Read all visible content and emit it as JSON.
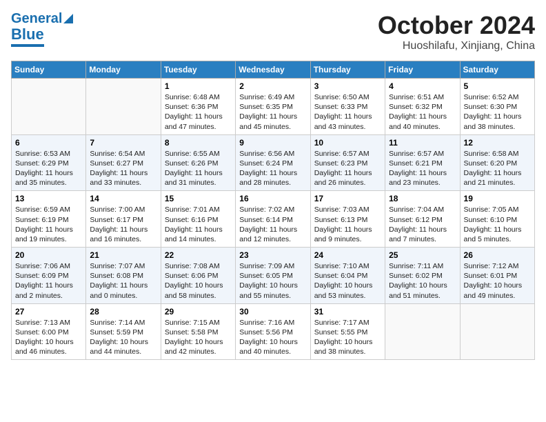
{
  "header": {
    "logo_line1": "General",
    "logo_line2": "Blue",
    "month": "October 2024",
    "location": "Huoshilafu, Xinjiang, China"
  },
  "days_of_week": [
    "Sunday",
    "Monday",
    "Tuesday",
    "Wednesday",
    "Thursday",
    "Friday",
    "Saturday"
  ],
  "weeks": [
    [
      {
        "day": "",
        "info": ""
      },
      {
        "day": "",
        "info": ""
      },
      {
        "day": "1",
        "info": "Sunrise: 6:48 AM\nSunset: 6:36 PM\nDaylight: 11 hours and 47 minutes."
      },
      {
        "day": "2",
        "info": "Sunrise: 6:49 AM\nSunset: 6:35 PM\nDaylight: 11 hours and 45 minutes."
      },
      {
        "day": "3",
        "info": "Sunrise: 6:50 AM\nSunset: 6:33 PM\nDaylight: 11 hours and 43 minutes."
      },
      {
        "day": "4",
        "info": "Sunrise: 6:51 AM\nSunset: 6:32 PM\nDaylight: 11 hours and 40 minutes."
      },
      {
        "day": "5",
        "info": "Sunrise: 6:52 AM\nSunset: 6:30 PM\nDaylight: 11 hours and 38 minutes."
      }
    ],
    [
      {
        "day": "6",
        "info": "Sunrise: 6:53 AM\nSunset: 6:29 PM\nDaylight: 11 hours and 35 minutes."
      },
      {
        "day": "7",
        "info": "Sunrise: 6:54 AM\nSunset: 6:27 PM\nDaylight: 11 hours and 33 minutes."
      },
      {
        "day": "8",
        "info": "Sunrise: 6:55 AM\nSunset: 6:26 PM\nDaylight: 11 hours and 31 minutes."
      },
      {
        "day": "9",
        "info": "Sunrise: 6:56 AM\nSunset: 6:24 PM\nDaylight: 11 hours and 28 minutes."
      },
      {
        "day": "10",
        "info": "Sunrise: 6:57 AM\nSunset: 6:23 PM\nDaylight: 11 hours and 26 minutes."
      },
      {
        "day": "11",
        "info": "Sunrise: 6:57 AM\nSunset: 6:21 PM\nDaylight: 11 hours and 23 minutes."
      },
      {
        "day": "12",
        "info": "Sunrise: 6:58 AM\nSunset: 6:20 PM\nDaylight: 11 hours and 21 minutes."
      }
    ],
    [
      {
        "day": "13",
        "info": "Sunrise: 6:59 AM\nSunset: 6:19 PM\nDaylight: 11 hours and 19 minutes."
      },
      {
        "day": "14",
        "info": "Sunrise: 7:00 AM\nSunset: 6:17 PM\nDaylight: 11 hours and 16 minutes."
      },
      {
        "day": "15",
        "info": "Sunrise: 7:01 AM\nSunset: 6:16 PM\nDaylight: 11 hours and 14 minutes."
      },
      {
        "day": "16",
        "info": "Sunrise: 7:02 AM\nSunset: 6:14 PM\nDaylight: 11 hours and 12 minutes."
      },
      {
        "day": "17",
        "info": "Sunrise: 7:03 AM\nSunset: 6:13 PM\nDaylight: 11 hours and 9 minutes."
      },
      {
        "day": "18",
        "info": "Sunrise: 7:04 AM\nSunset: 6:12 PM\nDaylight: 11 hours and 7 minutes."
      },
      {
        "day": "19",
        "info": "Sunrise: 7:05 AM\nSunset: 6:10 PM\nDaylight: 11 hours and 5 minutes."
      }
    ],
    [
      {
        "day": "20",
        "info": "Sunrise: 7:06 AM\nSunset: 6:09 PM\nDaylight: 11 hours and 2 minutes."
      },
      {
        "day": "21",
        "info": "Sunrise: 7:07 AM\nSunset: 6:08 PM\nDaylight: 11 hours and 0 minutes."
      },
      {
        "day": "22",
        "info": "Sunrise: 7:08 AM\nSunset: 6:06 PM\nDaylight: 10 hours and 58 minutes."
      },
      {
        "day": "23",
        "info": "Sunrise: 7:09 AM\nSunset: 6:05 PM\nDaylight: 10 hours and 55 minutes."
      },
      {
        "day": "24",
        "info": "Sunrise: 7:10 AM\nSunset: 6:04 PM\nDaylight: 10 hours and 53 minutes."
      },
      {
        "day": "25",
        "info": "Sunrise: 7:11 AM\nSunset: 6:02 PM\nDaylight: 10 hours and 51 minutes."
      },
      {
        "day": "26",
        "info": "Sunrise: 7:12 AM\nSunset: 6:01 PM\nDaylight: 10 hours and 49 minutes."
      }
    ],
    [
      {
        "day": "27",
        "info": "Sunrise: 7:13 AM\nSunset: 6:00 PM\nDaylight: 10 hours and 46 minutes."
      },
      {
        "day": "28",
        "info": "Sunrise: 7:14 AM\nSunset: 5:59 PM\nDaylight: 10 hours and 44 minutes."
      },
      {
        "day": "29",
        "info": "Sunrise: 7:15 AM\nSunset: 5:58 PM\nDaylight: 10 hours and 42 minutes."
      },
      {
        "day": "30",
        "info": "Sunrise: 7:16 AM\nSunset: 5:56 PM\nDaylight: 10 hours and 40 minutes."
      },
      {
        "day": "31",
        "info": "Sunrise: 7:17 AM\nSunset: 5:55 PM\nDaylight: 10 hours and 38 minutes."
      },
      {
        "day": "",
        "info": ""
      },
      {
        "day": "",
        "info": ""
      }
    ]
  ]
}
